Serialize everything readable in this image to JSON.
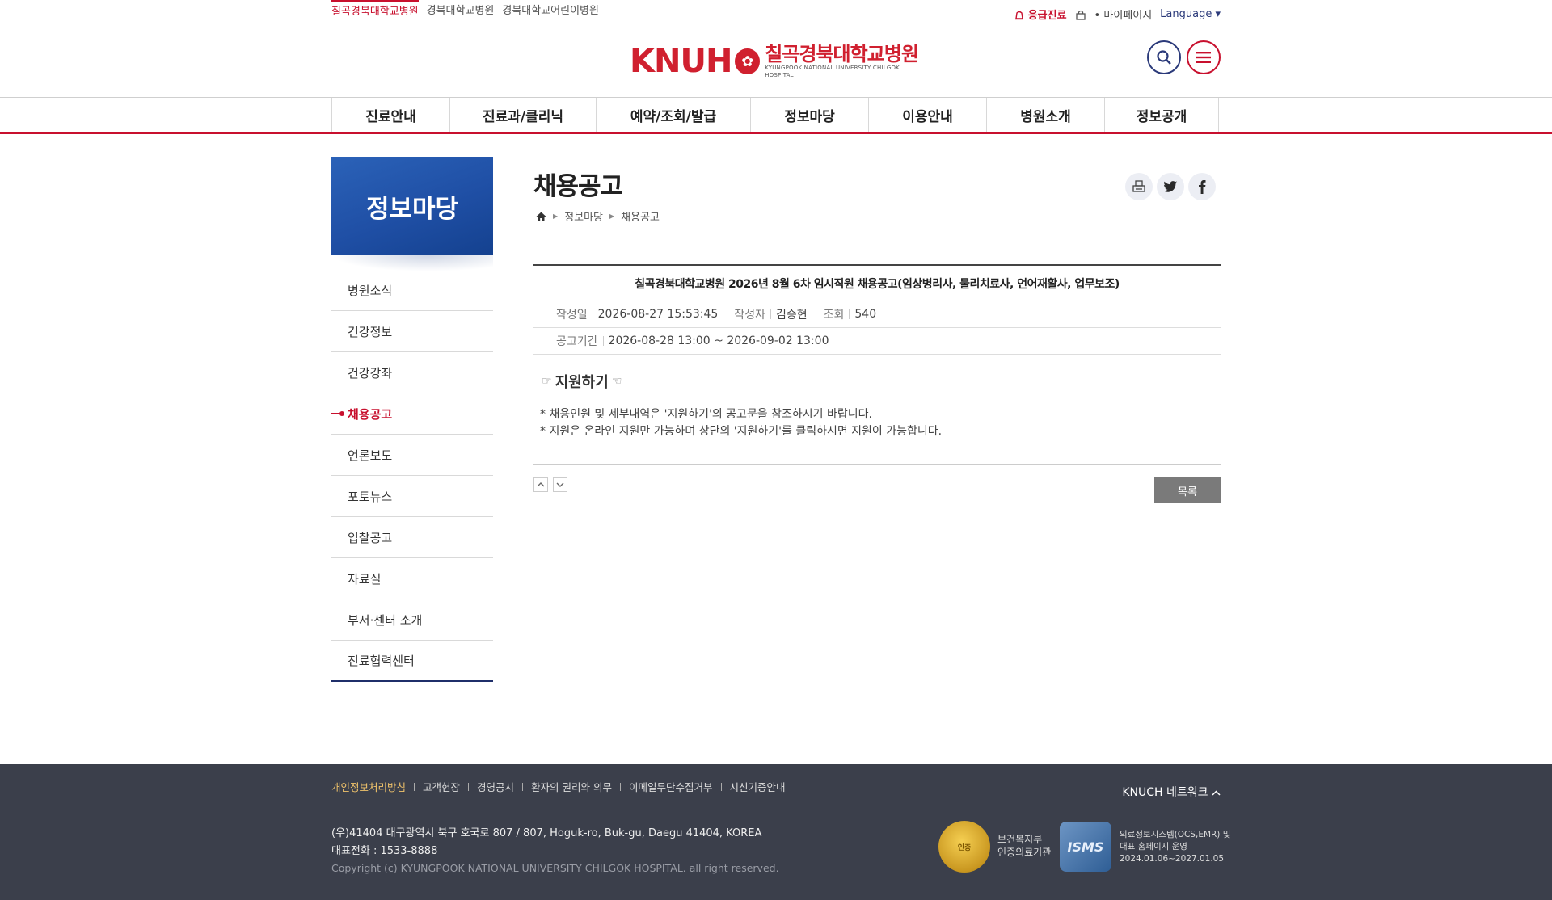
{
  "top_sites": [
    "칠곡경북대학교병원",
    "경북대학교병원",
    "경북대학교어린이병원"
  ],
  "top_util": {
    "emergency": "응급진료",
    "mypage": "마이페이지",
    "language": "Language ▾"
  },
  "logo": {
    "mark": "KNUH",
    "name_ko": "칠곡경북대학교병원",
    "name_en": "KYUNGPOOK NATIONAL UNIVERSITY CHILGOK HOSPITAL"
  },
  "gnb": [
    "진료안내",
    "진료과/클리닉",
    "예약/조회/발급",
    "정보마당",
    "이용안내",
    "병원소개",
    "정보공개"
  ],
  "lnb": {
    "title": "정보마당",
    "items": [
      "병원소식",
      "건강정보",
      "건강강좌",
      "채용공고",
      "언론보도",
      "포토뉴스",
      "입찰공고",
      "자료실",
      "부서·센터 소개",
      "진료협력센터"
    ],
    "active_index": 3
  },
  "content": {
    "title": "채용공고",
    "breadcrumb": [
      "정보마당",
      "채용공고"
    ],
    "subject": "칠곡경북대학교병원 2026년 8월 6차 임시직원 채용공고(임상병리사, 물리치료사, 언어재활사, 업무보조)",
    "meta": {
      "date_label": "작성일",
      "date": "2026-08-27 15:53:45",
      "author_label": "작성자",
      "author": "김승현",
      "views_label": "조회",
      "views": "540",
      "period_label": "공고기간",
      "period": "2026-08-28 13:00 ~ 2026-09-02 13:00"
    },
    "apply_label": "지원하기",
    "notes": [
      "* 채용인원 및 세부내역은 '지원하기'의 공고문을 참조하시기 바랍니다.",
      "* 지원은 온라인 지원만 가능하며 상단의 '지원하기'를 클릭하시면 지원이 가능합니다."
    ],
    "list_button": "목록"
  },
  "footer": {
    "links": [
      "개인정보처리방침",
      "고객헌장",
      "경영공시",
      "환자의 권리와 의무",
      "이메일무단수집거부",
      "시신기증안내"
    ],
    "network": "KNUCH 네트워크",
    "address": "(우)41404 대구광역시 북구 호국로 807 / 807, Hoguk-ro, Buk-gu, Daegu 41404, KOREA",
    "phone": "대표전화 : 1533-8888",
    "copyright": "Copyright (c) KYUNGPOOK NATIONAL UNIVERSITY CHILGOK HOSPITAL. all right reserved.",
    "badge1_text": [
      "보건복지부",
      "인증의료기관"
    ],
    "badge2_text": [
      "의료정보시스템(OCS,EMR) 및",
      "대표 홈페이지 운영",
      "2024.01.06~2027.01.05"
    ]
  },
  "colors": {
    "brand_red": "#c8102e",
    "navy": "#2b3a7a",
    "lnb_blue": "#1f4fa5",
    "footer_bg": "#3b3f4b"
  }
}
